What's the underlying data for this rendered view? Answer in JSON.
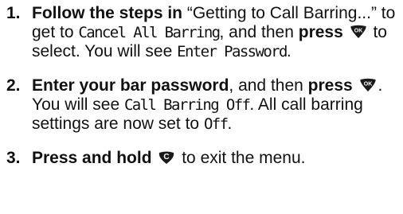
{
  "steps": [
    {
      "number": "1.",
      "bold_lead": "Follow the steps in",
      "text_a": " “Getting to Call Barring...” to get to ",
      "display_a": "Cancel All Barring",
      "text_b": ", and then ",
      "bold_b": "press",
      "key": "ok-key-icon",
      "key_label": "OK",
      "text_c": " to select. You will see ",
      "display_b": "Enter Password",
      "text_d": "."
    },
    {
      "number": "2.",
      "bold_lead": "Enter your bar password",
      "text_a": ", and then ",
      "bold_b": "press",
      "key": "ok-key-icon",
      "key_label": "OK",
      "text_c": ". You will see ",
      "display_a": "Call Barring Off",
      "text_d": ". All call barring settings are now set to ",
      "display_b": "Off",
      "text_e": "."
    },
    {
      "number": "3.",
      "bold_lead": "Press and hold",
      "key": "clear-key-icon",
      "key_label": "C",
      "text_a": " to exit the menu."
    }
  ],
  "colors": {
    "key_fill": "#1a1a1a",
    "key_text": "#ffffff",
    "text": "#111111"
  }
}
